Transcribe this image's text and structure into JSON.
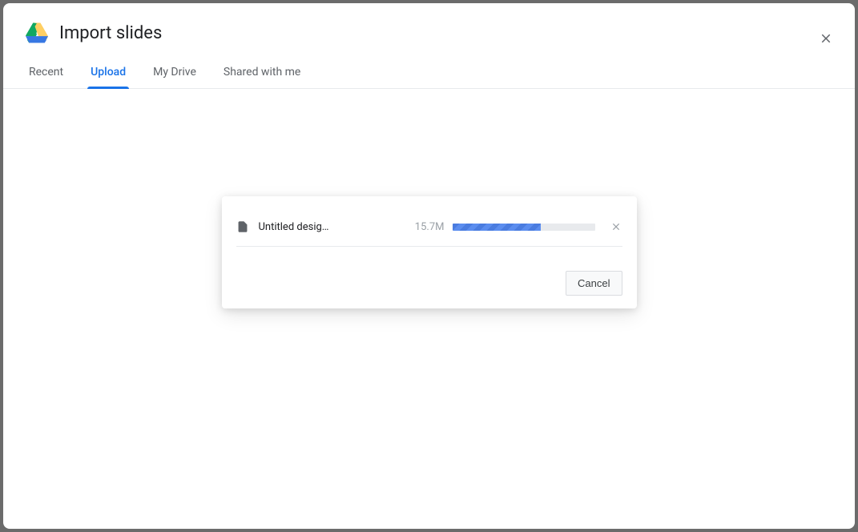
{
  "dialog": {
    "title": "Import slides"
  },
  "tabs": {
    "recent": "Recent",
    "upload": "Upload",
    "mydrive": "My Drive",
    "shared": "Shared with me",
    "active": "upload"
  },
  "upload": {
    "file_name": "Untitled desig…",
    "file_size": "15.7M",
    "progress_percent": 62,
    "cancel_label": "Cancel"
  }
}
